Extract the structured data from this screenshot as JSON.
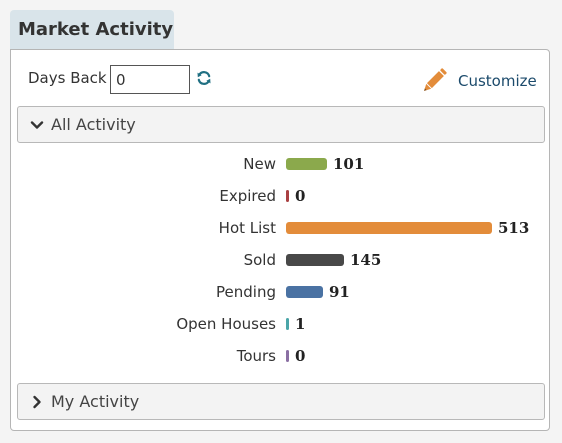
{
  "widget": {
    "title": "Market Activity"
  },
  "toolbar": {
    "days_back_label": "Days Back",
    "days_back_value": "0",
    "refresh_icon": "refresh-icon",
    "customize_icon": "pencil-icon",
    "customize_label": "Customize"
  },
  "sections": {
    "all_activity": {
      "label": "All Activity",
      "expanded": true
    },
    "my_activity": {
      "label": "My Activity",
      "expanded": false
    }
  },
  "colors": {
    "tab_bg": "#d9e4ea",
    "accent_teal": "#1f6f82",
    "pencil": "#e38c3a",
    "link": "#1b4a6b"
  },
  "chart_data": {
    "type": "bar",
    "orientation": "horizontal",
    "categories": [
      "New",
      "Expired",
      "Hot List",
      "Sold",
      "Pending",
      "Open Houses",
      "Tours"
    ],
    "values": [
      101,
      0,
      513,
      145,
      91,
      1,
      0
    ],
    "bar_colors": [
      "#8ba94c",
      "#a94042",
      "#e38c3a",
      "#484848",
      "#4a72a3",
      "#4aa5a8",
      "#8a6fa3"
    ]
  }
}
